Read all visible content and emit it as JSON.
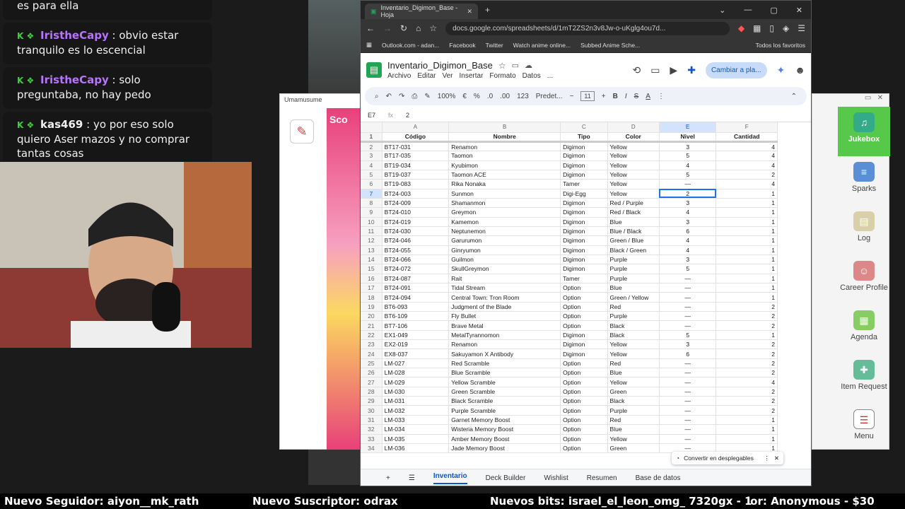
{
  "chat": {
    "top_fragment": "es para ella",
    "messages": [
      {
        "user": "IristheCapy",
        "text": ": obvio estar tranquilo es lo escencial",
        "color": "#b874ff"
      },
      {
        "user": "IristheCapy",
        "text": ": solo preguntaba, no hay pedo",
        "color": "#b874ff"
      },
      {
        "user": "kas469",
        "text": ": yo por eso solo quiero Aser mazos y no comprar tantas cosas",
        "color": "#f0f0f0"
      }
    ]
  },
  "uma_window": {
    "title": "Umamusume",
    "art_label": "Sco"
  },
  "side_panel": {
    "items": [
      "Jukebox",
      "Sparks",
      "Log",
      "Career Profile",
      "Agenda",
      "Item Request",
      "Menu"
    ]
  },
  "browser": {
    "tab_title": "Inventario_Digimon_Base - Hoja",
    "url": "docs.google.com/spreadsheets/d/1mT2ZS2n3v8Jw-o-uKglg4ou7d...",
    "bookmarks": [
      "Outlook.com - adan...",
      "Facebook",
      "Twitter",
      "Watch anime online...",
      "Subbed Anime Sche..."
    ],
    "bookmarks_right": "Todos los favoritos"
  },
  "sheets": {
    "doc_title": "Inventario_Digimon_Base",
    "menu": [
      "Archivo",
      "Editar",
      "Ver",
      "Insertar",
      "Formato",
      "Datos",
      "..."
    ],
    "share_label": "Cambiar a pla...",
    "zoom": "100%",
    "font": "Predet...",
    "font_size": "11",
    "cell_ref": "E7",
    "formula_value": "2",
    "columns": [
      "A",
      "B",
      "C",
      "D",
      "E",
      "F"
    ],
    "headers": [
      "Código",
      "Nombre",
      "Tipo",
      "Color",
      "Nivel",
      "Cantidad"
    ],
    "rows": [
      [
        "BT17-031",
        "Renamon",
        "Digimon",
        "Yellow",
        "3",
        "4"
      ],
      [
        "BT17-035",
        "Taomon",
        "Digimon",
        "Yellow",
        "5",
        "4"
      ],
      [
        "BT19-034",
        "Kyubimon",
        "Digimon",
        "Yellow",
        "4",
        "4"
      ],
      [
        "BT19-037",
        "Taomon ACE",
        "Digimon",
        "Yellow",
        "5",
        "2"
      ],
      [
        "BT19-083",
        "Rika Nonaka",
        "Tamer",
        "Yellow",
        "—",
        "4"
      ],
      [
        "BT24-003",
        "Sunmon",
        "Digi-Egg",
        "Yellow",
        "2",
        "1"
      ],
      [
        "BT24-009",
        "Shamanmon",
        "Digimon",
        "Red / Purple",
        "3",
        "1"
      ],
      [
        "BT24-010",
        "Greymon",
        "Digimon",
        "Red / Black",
        "4",
        "1"
      ],
      [
        "BT24-019",
        "Kamemon",
        "Digimon",
        "Blue",
        "3",
        "1"
      ],
      [
        "BT24-030",
        "Neptunemon",
        "Digimon",
        "Blue / Black",
        "6",
        "1"
      ],
      [
        "BT24-046",
        "Garurumon",
        "Digimon",
        "Green / Blue",
        "4",
        "1"
      ],
      [
        "BT24-055",
        "Ginryumon",
        "Digimon",
        "Black / Green",
        "4",
        "1"
      ],
      [
        "BT24-066",
        "Guilmon",
        "Digimon",
        "Purple",
        "3",
        "1"
      ],
      [
        "BT24-072",
        "SkullGreymon",
        "Digimon",
        "Purple",
        "5",
        "1"
      ],
      [
        "BT24-087",
        "Rait",
        "Tamer",
        "Purple",
        "—",
        "1"
      ],
      [
        "BT24-091",
        "Tidal Stream",
        "Option",
        "Blue",
        "—",
        "1"
      ],
      [
        "BT24-094",
        "Central Town: Tron Room",
        "Option",
        "Green / Yellow",
        "—",
        "1"
      ],
      [
        "BT6-093",
        "Judgment of the Blade",
        "Option",
        "Red",
        "—",
        "2"
      ],
      [
        "BT6-109",
        "Fly Bullet",
        "Option",
        "Purple",
        "—",
        "2"
      ],
      [
        "BT7-106",
        "Brave Metal",
        "Option",
        "Black",
        "—",
        "2"
      ],
      [
        "EX1-049",
        "MetalTyrannomon",
        "Digimon",
        "Black",
        "5",
        "1"
      ],
      [
        "EX2-019",
        "Renamon",
        "Digimon",
        "Yellow",
        "3",
        "2"
      ],
      [
        "EX8-037",
        "Sakuyamon X Antibody",
        "Digimon",
        "Yellow",
        "6",
        "2"
      ],
      [
        "LM-027",
        "Red Scramble",
        "Option",
        "Red",
        "—",
        "2"
      ],
      [
        "LM-028",
        "Blue Scramble",
        "Option",
        "Blue",
        "—",
        "2"
      ],
      [
        "LM-029",
        "Yellow Scramble",
        "Option",
        "Yellow",
        "—",
        "4"
      ],
      [
        "LM-030",
        "Green Scramble",
        "Option",
        "Green",
        "—",
        "2"
      ],
      [
        "LM-031",
        "Black Scramble",
        "Option",
        "Black",
        "—",
        "2"
      ],
      [
        "LM-032",
        "Purple Scramble",
        "Option",
        "Purple",
        "—",
        "2"
      ],
      [
        "LM-033",
        "Garnet Memory Boost",
        "Option",
        "Red",
        "—",
        "1"
      ],
      [
        "LM-034",
        "Wisteria Memory Boost",
        "Option",
        "Blue",
        "—",
        "1"
      ],
      [
        "LM-035",
        "Amber Memory Boost",
        "Option",
        "Yellow",
        "—",
        "1"
      ],
      [
        "LM-036",
        "Jade Memory Boost",
        "Option",
        "Green",
        "—",
        "1"
      ]
    ],
    "toast": "Convertir en desplegables",
    "sheet_tabs": [
      "Inventario",
      "Deck Builder",
      "Wishlist",
      "Resumen",
      "Base de datos"
    ]
  },
  "ticker": {
    "follower": "Nuevo Seguidor: aiyon__mk_rath",
    "subscriber": "Nuevo Suscriptor: odrax",
    "bits": "Nuevos bits: israel_el_leon_omg_ 7320gx - 1",
    "donor": "lor: Anonymous - $30"
  }
}
